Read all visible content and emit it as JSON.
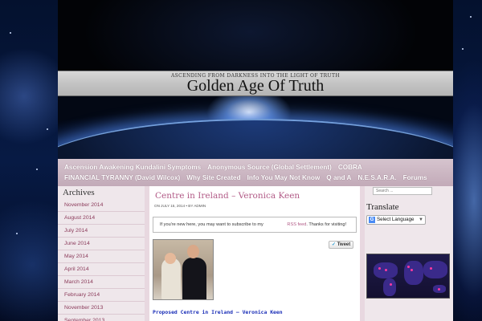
{
  "header": {
    "tagline": "ASCENDING FROM DARKNESS INTO THE LIGHT OF TRUTH",
    "site_title": "Golden Age Of Truth"
  },
  "nav": {
    "row1": [
      "Ascension Awakening Kundalini Symptoms",
      "Anonymous Source (Global Settlement)",
      "COBRA"
    ],
    "row2": [
      "FINANCIAL TYRANNY (David Wilcox)",
      "Why Site Created",
      "Info You May Not Know",
      "Q and A",
      "N.E.S.A.R.A.",
      "Forums"
    ]
  },
  "archives": {
    "title": "Archives",
    "items": [
      "November 2014",
      "August 2014",
      "July 2014",
      "June 2014",
      "May 2014",
      "April 2014",
      "March 2014",
      "February 2014",
      "November 2013",
      "September 2013"
    ]
  },
  "post": {
    "title": "Centre in Ireland – Veronica Keen",
    "meta": "ON JULY 15, 2014 • BY ADMIN",
    "notice_text": "If you're new here, you may want to subscribe to my",
    "notice_link": "RSS feed",
    "notice_tail": ". Thanks for visiting!",
    "tweet_label": "Tweet",
    "link_text": "Proposed Centre in Ireland – Veronica Keen"
  },
  "sidebar": {
    "search_placeholder": "Search ...",
    "translate_title": "Translate",
    "language_select": "Select Language"
  },
  "colors": {
    "accent": "#b25b87",
    "nav_bg": "#c8b2c0",
    "link_blue": "#1b2fb8"
  }
}
